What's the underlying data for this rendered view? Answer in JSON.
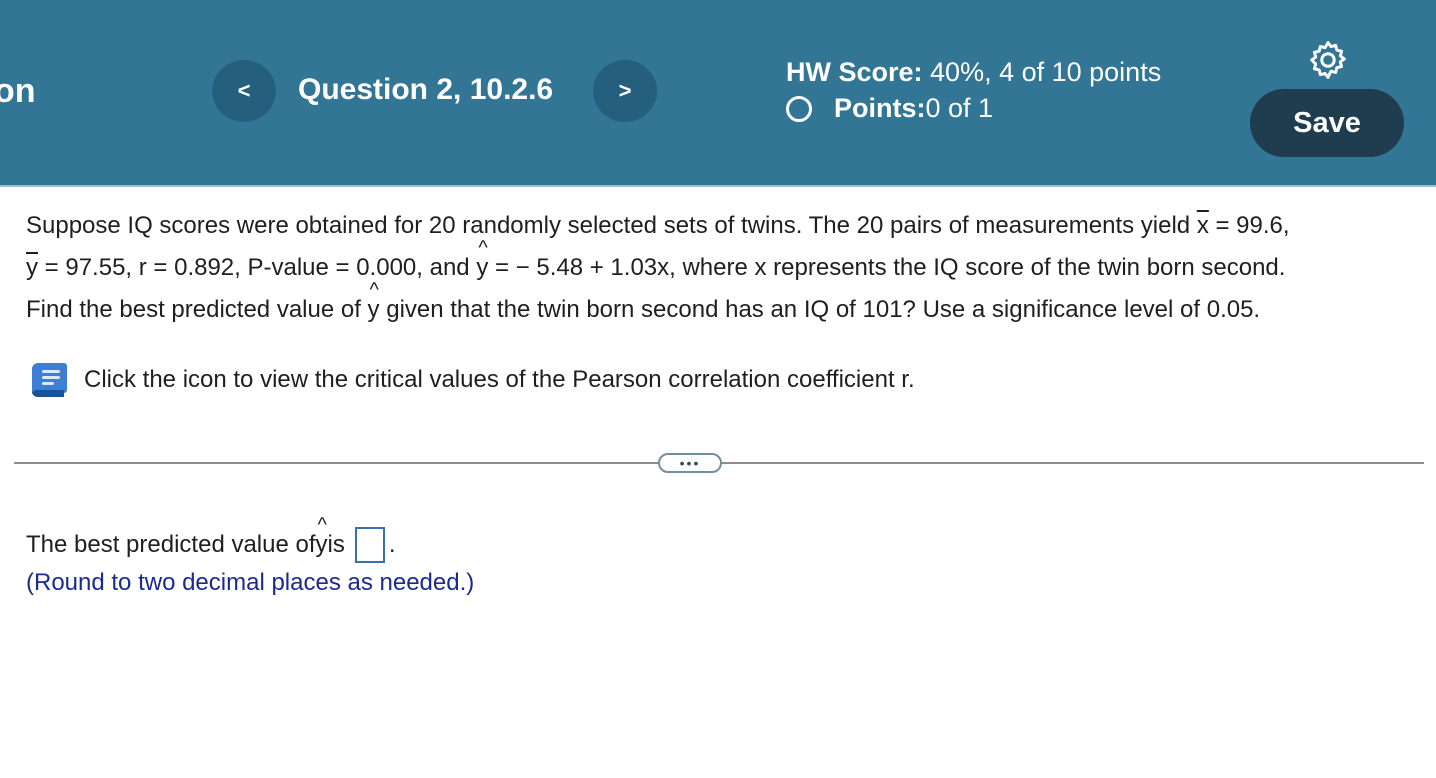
{
  "header": {
    "cut_title": "on",
    "prev_glyph": "<",
    "next_glyph": ">",
    "question_label": "Question 2, 10.2.6",
    "hw_score_label": "HW Score:",
    "hw_score_value": " 40%, 4 of 10 points",
    "points_label": "Points:",
    "points_value": " 0 of 1",
    "save_label": "Save",
    "settings_icon": "gear-icon",
    "bg_color": "#327594"
  },
  "problem": {
    "line1_a": "Suppose IQ scores were obtained for 20 randomly selected sets of twins. The 20 pairs of measurements yield ",
    "line1_xbar": "x",
    "line1_b": " = 99.6,",
    "line2_ybar": "y",
    "line2_a": " = 97.55, r = 0.892, P-value = 0.000, and ",
    "line2_yhat": "y",
    "line2_b": " =  − 5.48 + 1.03x, where x represents the IQ score of the twin born second.",
    "line3_a": "Find the best predicted value of ",
    "line3_yhat": "y",
    "line3_b": " given that the twin born second has an IQ of 101? Use a significance level of 0.05."
  },
  "resource": {
    "icon": "book-icon",
    "text": "Click the icon to view the critical values of the Pearson correlation coefficient r."
  },
  "more_button": "•••",
  "answer": {
    "prefix": "The best predicted value of ",
    "yhat": "y",
    "suffix_is": " is",
    "period": ".",
    "hint": "(Round to two decimal places as needed.)",
    "input_value": ""
  }
}
